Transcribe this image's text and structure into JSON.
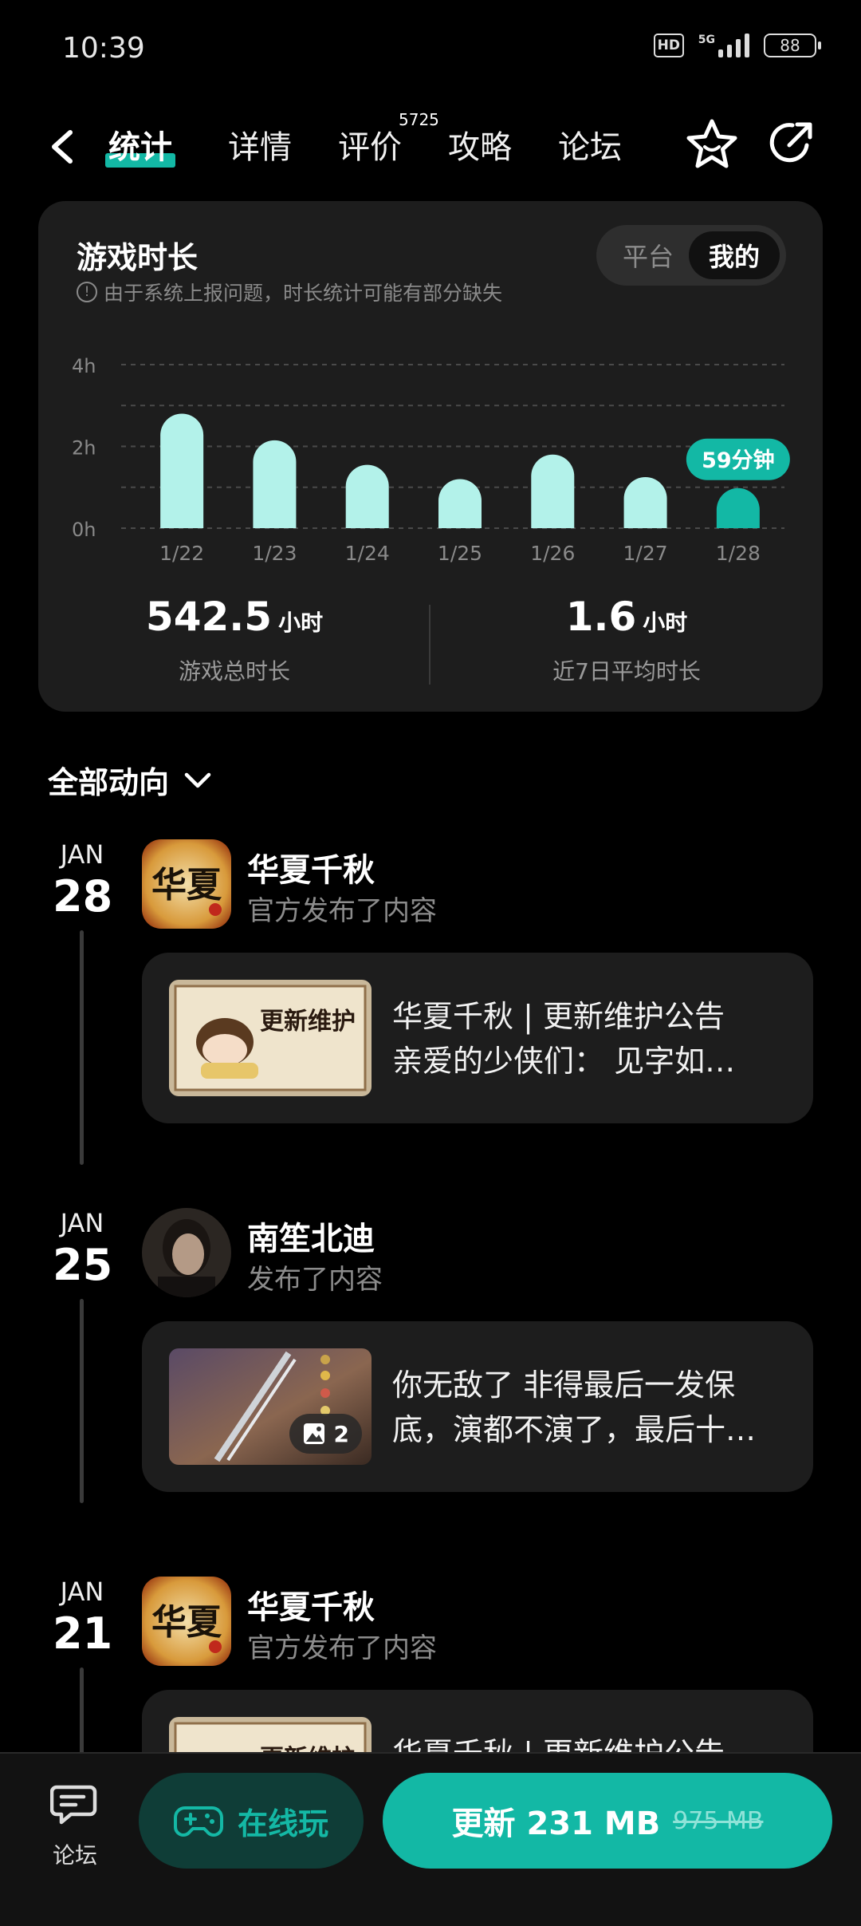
{
  "status_bar": {
    "time": "10:39",
    "hd": "HD",
    "network": "5G",
    "battery": "88"
  },
  "nav": {
    "tabs": [
      {
        "label": "统计",
        "active": true
      },
      {
        "label": "详情"
      },
      {
        "label": "评价"
      },
      {
        "label": "攻略"
      },
      {
        "label": "论坛"
      }
    ],
    "review_count": "5725"
  },
  "playtime": {
    "title": "游戏时长",
    "note": "由于系统上报问题，时长统计可能有部分缺失",
    "toggle": [
      "平台",
      "我的"
    ],
    "selected": "我的",
    "total_value": "542.5",
    "total_unit": "小时",
    "total_label": "游戏总时长",
    "avg_value": "1.6",
    "avg_unit": "小时",
    "avg_label": "近7日平均时长"
  },
  "chart_data": {
    "type": "bar",
    "categories": [
      "1/22",
      "1/23",
      "1/24",
      "1/25",
      "1/26",
      "1/27",
      "1/28"
    ],
    "values": [
      2.8,
      2.15,
      1.55,
      1.2,
      1.8,
      1.25,
      0.98
    ],
    "ylim": [
      0,
      4
    ],
    "yticks": [
      "0h",
      "2h",
      "4h"
    ],
    "highlight_index": 6,
    "highlight_label": "59分钟",
    "grid": true,
    "colors": {
      "bar": "#b3f2ea",
      "highlight": "#13b8a5"
    }
  },
  "feed": {
    "filter_label": "全部动向",
    "items": [
      {
        "month": "JAN",
        "day": "28",
        "author": "华夏千秋",
        "action": "官方发布了内容",
        "avatar_text": "华夏",
        "line1": "华夏千秋 | 更新维护公告",
        "line2": "亲爱的少侠们： 见字如…",
        "thumb_text": "更新维护"
      },
      {
        "month": "JAN",
        "day": "25",
        "author": "南笙北迪",
        "action": "发布了内容",
        "line1": "你无敌了 非得最后一发保",
        "line2": "底，演都不演了，最后十…",
        "image_count": "2"
      },
      {
        "month": "JAN",
        "day": "21",
        "author": "华夏千秋",
        "action": "官方发布了内容",
        "avatar_text": "华夏",
        "line1": "华夏千秋 | 更新维护公告",
        "thumb_text": "更新维护"
      }
    ]
  },
  "bottom": {
    "forum_label": "论坛",
    "cloud_play": "在线玩",
    "update_label": "更新 231 MB",
    "old_size": "975 MB"
  },
  "colors": {
    "accent": "#13b8a5",
    "card": "#1d1d1d"
  }
}
